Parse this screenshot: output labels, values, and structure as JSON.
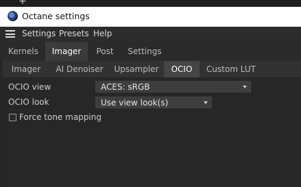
{
  "window": {
    "title": "Octane settings"
  },
  "menu": {
    "items": [
      "Settings",
      "Presets",
      "Help"
    ]
  },
  "main_tabs": [
    {
      "label": "Kernels",
      "active": false
    },
    {
      "label": "Imager",
      "active": true
    },
    {
      "label": "Post",
      "active": false
    },
    {
      "label": "Settings",
      "active": false
    }
  ],
  "sub_tabs": [
    {
      "label": "Imager",
      "active": false
    },
    {
      "label": "AI Denoiser",
      "active": false
    },
    {
      "label": "Upsampler",
      "active": false
    },
    {
      "label": "OCIO",
      "active": true
    },
    {
      "label": "Custom LUT",
      "active": false
    }
  ],
  "ocio": {
    "view_label": "OCIO view",
    "view_value": "ACES: sRGB",
    "look_label": "OCIO look",
    "look_value": "Use view look(s)",
    "force_label": "Force tone mapping",
    "force_checked": false
  }
}
